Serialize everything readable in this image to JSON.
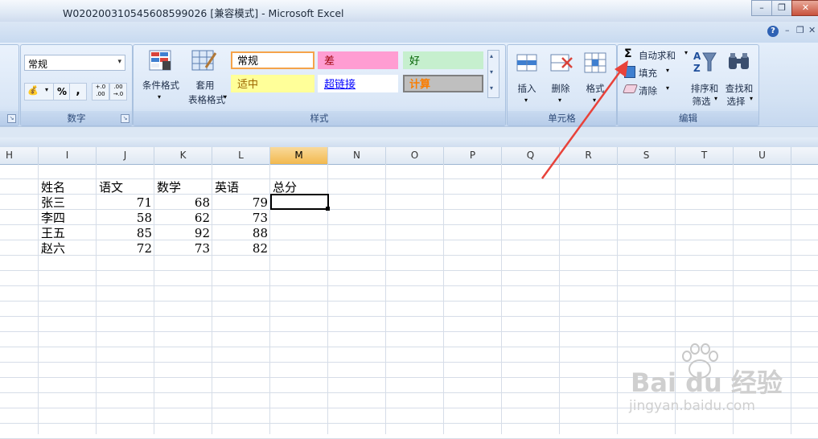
{
  "window": {
    "title": "W020200310545608599026  [兼容模式] - Microsoft Excel",
    "minimize_glyph": "–",
    "restore_glyph": "❐",
    "close_glyph": "✕",
    "help_glyph": "?",
    "ribbon_min_glyph": "–",
    "ribbon_restore_glyph": "❐",
    "ribbon_close_glyph": "✕"
  },
  "ribbon": {
    "number_group": {
      "label": "数字",
      "format_value": "常规",
      "percent": "%",
      "comma": ",",
      "inc_decimal": "+.0 .00",
      "dec_decimal": ".00 →.0"
    },
    "styles_group": {
      "label": "样式",
      "conditional_format_label": "条件格式",
      "table_format_label_1": "套用",
      "table_format_label_2": "表格格式",
      "cells": [
        {
          "text": "常规",
          "bg": "#ffffff",
          "color": "#000000",
          "border": "#f5a34a"
        },
        {
          "text": "差",
          "bg": "#ff9dd2",
          "color": "#9c0006",
          "border": "#ff9dd2"
        },
        {
          "text": "好",
          "bg": "#c6efce",
          "color": "#006100",
          "border": "#c6efce"
        },
        {
          "text": "适中",
          "bg": "#ffff99",
          "color": "#9c6500",
          "border": "#ffff99"
        },
        {
          "text": "超链接",
          "bg": "#ffffff",
          "color": "#0000ff",
          "border": "#ffffff"
        },
        {
          "text": "计算",
          "bg": "#bfbfbf",
          "color": "#fa7d00",
          "border": "#7f7f7f"
        }
      ]
    },
    "cells_group": {
      "label": "单元格",
      "insert": "插入",
      "delete": "删除",
      "format": "格式"
    },
    "editing_group": {
      "label": "编辑",
      "autosum": "自动求和",
      "fill": "填充",
      "clear": "清除",
      "sort_1": "排序和",
      "sort_2": "筛选",
      "find_1": "查找和",
      "find_2": "选择",
      "sigma": "Σ"
    }
  },
  "sheet": {
    "columns": [
      "H",
      "I",
      "J",
      "K",
      "L",
      "M",
      "N",
      "O",
      "P",
      "Q",
      "R",
      "S",
      "T",
      "U"
    ],
    "selected_column": "M",
    "headers": [
      "姓名",
      "语文",
      "数学",
      "英语",
      "总分"
    ],
    "rows": [
      {
        "name": "张三",
        "chinese": "71",
        "math": "68",
        "english": "79"
      },
      {
        "name": "李四",
        "chinese": "58",
        "math": "62",
        "english": "73"
      },
      {
        "name": "王五",
        "chinese": "85",
        "math": "92",
        "english": "88"
      },
      {
        "name": "赵六",
        "chinese": "72",
        "math": "73",
        "english": "82"
      }
    ]
  },
  "colors": {
    "accent": "#e8423a",
    "selected_header": "#f2b94e"
  },
  "watermark": {
    "logo": "Bai du 经验",
    "url": "jingyan.baidu.com"
  }
}
